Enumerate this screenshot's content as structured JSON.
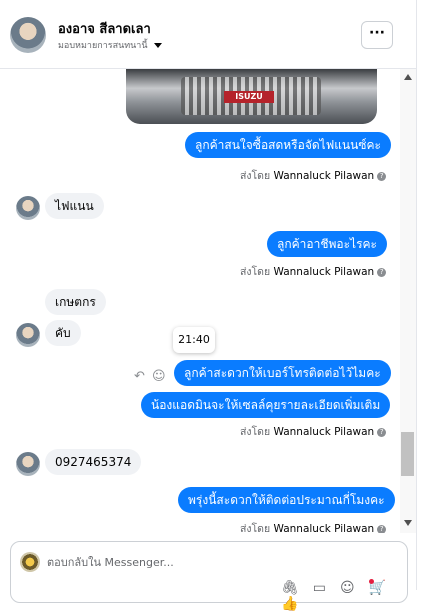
{
  "header": {
    "name": "องอาจ สีลาดเลา",
    "assign_label": "มอบหมายการสนทนานี้",
    "more_label": "···"
  },
  "thread": {
    "photo_logo": "ISUZU",
    "messages": [
      {
        "side": "out",
        "text": "ลูกค้าสนใจซื้อสดหรือจัดไฟแนนซ์คะ"
      },
      {
        "side": "in",
        "text": "ไฟแนน"
      },
      {
        "side": "out",
        "text": "ลูกค้าอาชีพอะไรคะ"
      },
      {
        "side": "in",
        "text": "เกษตกร"
      },
      {
        "side": "in",
        "text": "คับ"
      },
      {
        "side": "out",
        "text": "ลูกค้าสะดวกให้เบอร์โทรติดต่อไว้ไมคะ"
      },
      {
        "side": "out",
        "text": "น้องแอดมินจะให้เซลล์คุยรายละเอียดเพิ่มเติม"
      },
      {
        "side": "in",
        "text": "0927465374"
      },
      {
        "side": "out",
        "text": "พรุ่งนี้สะดวกให้ติดต่อประมาณกี่โมงคะ"
      }
    ],
    "sent_by_prefix": "ส่งโดย",
    "sent_by_name": "Wannaluck Pilawan",
    "tooltip_time": "21:40"
  },
  "composer": {
    "placeholder": "ตอบกลับใน Messenger..."
  },
  "colors": {
    "accent": "#0a7cff",
    "incoming": "#f0f2f5"
  }
}
